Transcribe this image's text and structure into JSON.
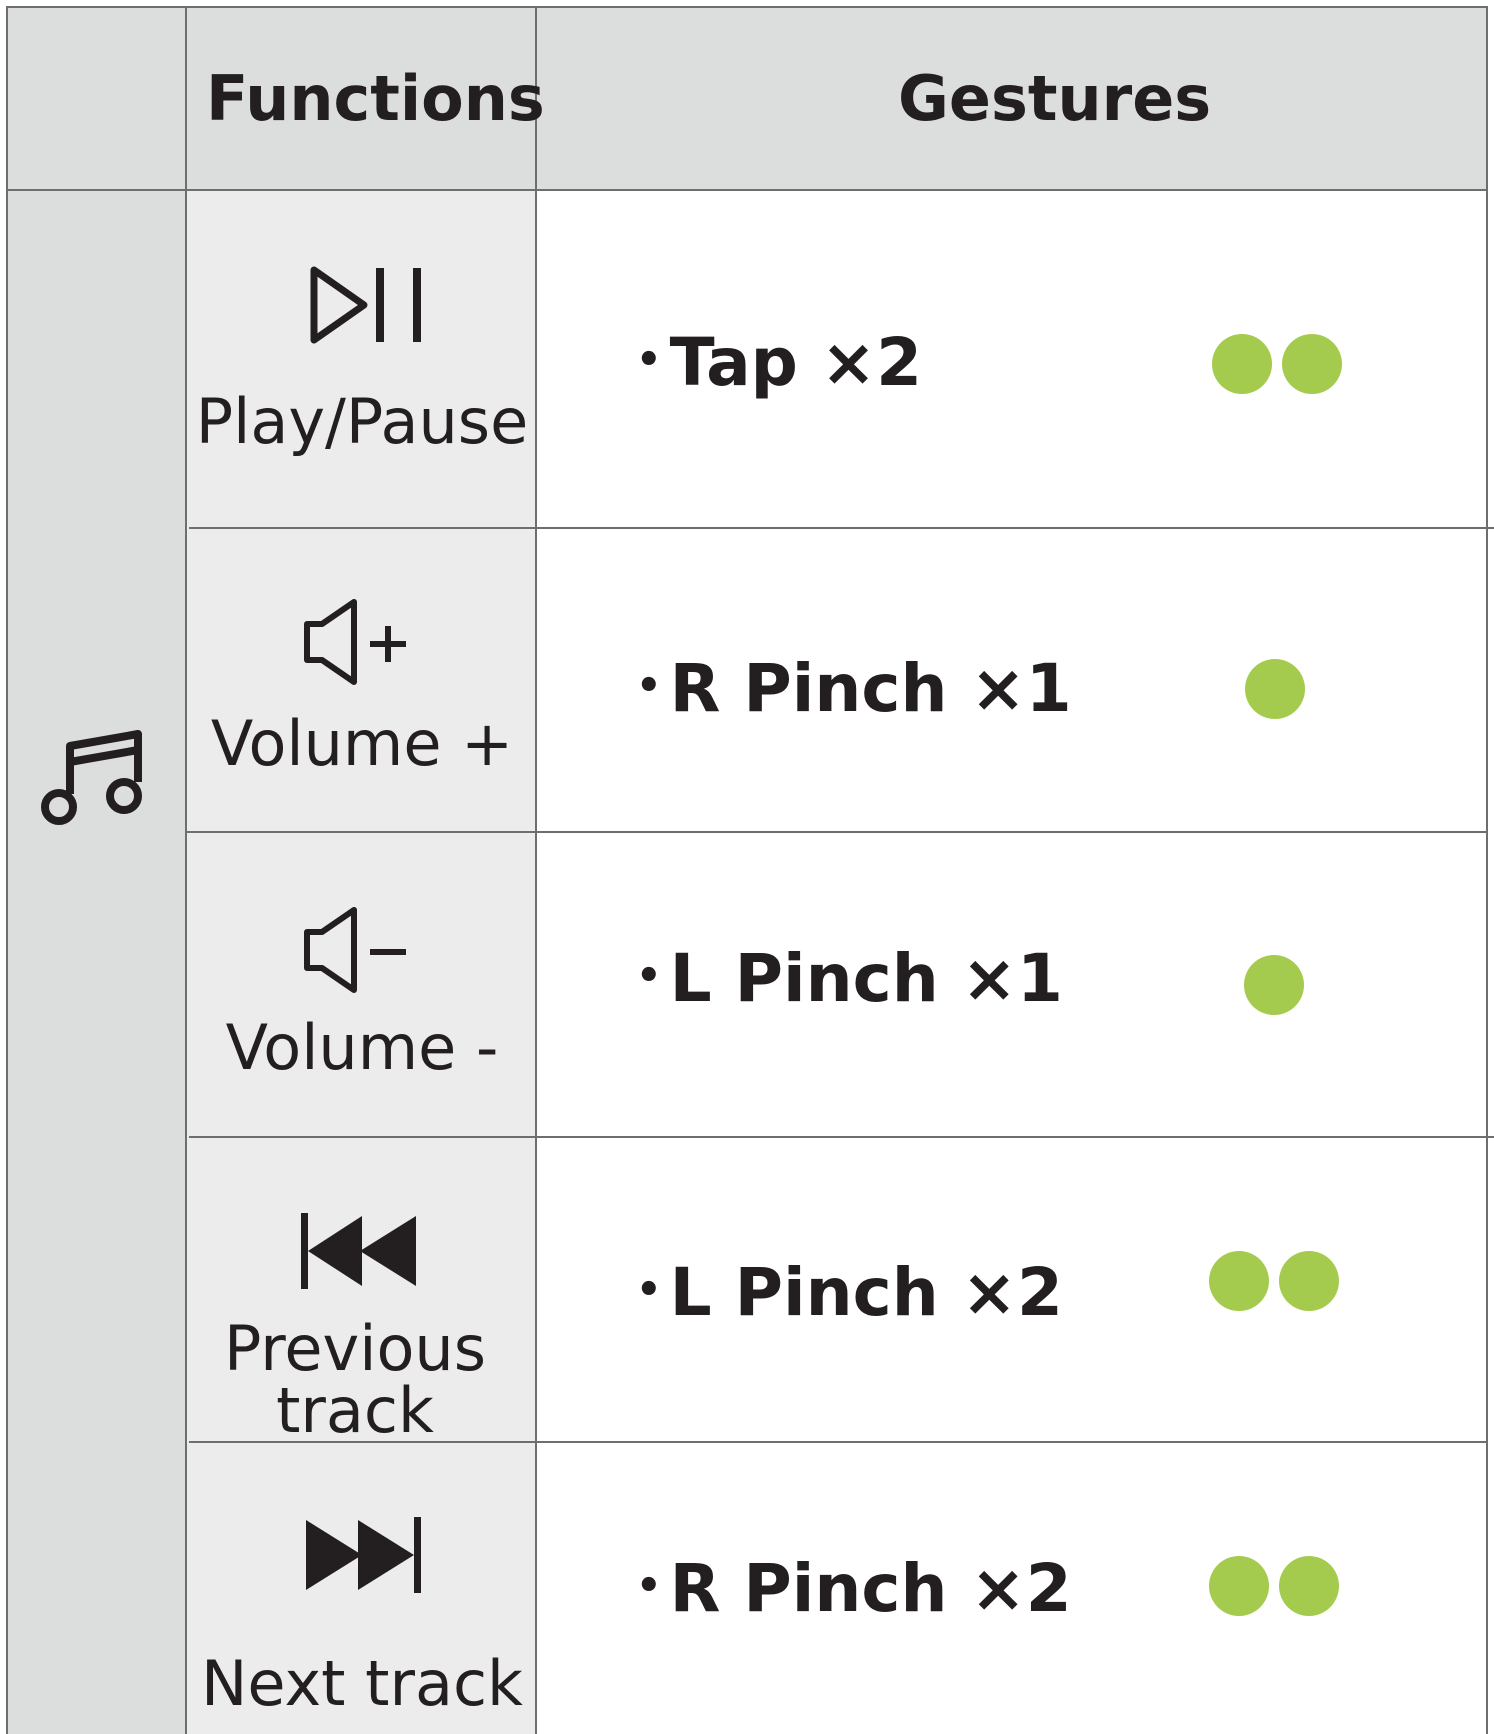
{
  "header": {
    "functions_label": "Functions",
    "gestures_label": "Gestures"
  },
  "category": {
    "icon": "music-note-icon"
  },
  "rows": [
    {
      "icon": "play-pause-icon",
      "label": "Play/Pause",
      "gesture": "Tap ×2",
      "taps": 2
    },
    {
      "icon": "volume-up-icon",
      "label": "Volume +",
      "gesture": "R Pinch ×1",
      "taps": 1
    },
    {
      "icon": "volume-down-icon",
      "label": "Volume -",
      "gesture": "L Pinch ×1",
      "taps": 1
    },
    {
      "icon": "previous-track-icon",
      "label": "Previous track",
      "gesture": "L Pinch ×2",
      "taps": 2
    },
    {
      "icon": "next-track-icon",
      "label": "Next track",
      "gesture": "R Pinch ×2",
      "taps": 2
    }
  ],
  "colors": {
    "header_bg": "#dcdedd",
    "function_cell_bg": "#ececec",
    "tap_dot": "#a4cb4d",
    "text": "#231f20",
    "border": "#6d6e71"
  }
}
